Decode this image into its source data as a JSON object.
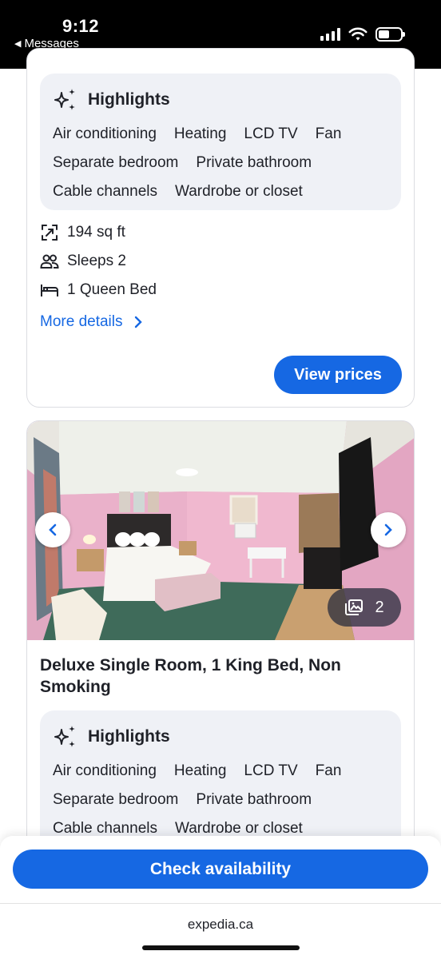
{
  "status_bar": {
    "time": "9:12",
    "back_label": "Messages"
  },
  "card1": {
    "highlights_title": "Highlights",
    "highlights_rows": [
      [
        "Air conditioning",
        "Heating",
        "LCD TV",
        "Fan"
      ],
      [
        "Separate bedroom",
        "Private bathroom"
      ],
      [
        "Cable channels",
        "Wardrobe or closet"
      ]
    ],
    "features": [
      {
        "icon": "resize-icon",
        "label": "194 sq ft"
      },
      {
        "icon": "people-icon",
        "label": "Sleeps 2"
      },
      {
        "icon": "bed-icon",
        "label": "1 Queen Bed"
      }
    ],
    "more_details": "More details",
    "view_prices": "View prices"
  },
  "card2": {
    "photo_count": "2",
    "room_title": "Deluxe Single Room, 1 King Bed, Non Smoking",
    "highlights_title": "Highlights",
    "highlights_rows": [
      [
        "Air conditioning",
        "Heating",
        "LCD TV",
        "Fan"
      ],
      [
        "Separate bedroom",
        "Private bathroom"
      ],
      [
        "Cable channels",
        "Wardrobe or closet"
      ]
    ]
  },
  "footer": {
    "check_availability": "Check availability",
    "url": "expedia.ca"
  },
  "colors": {
    "primary": "#1668e3",
    "highlight_bg": "#eff1f6",
    "text": "#1f2128"
  }
}
